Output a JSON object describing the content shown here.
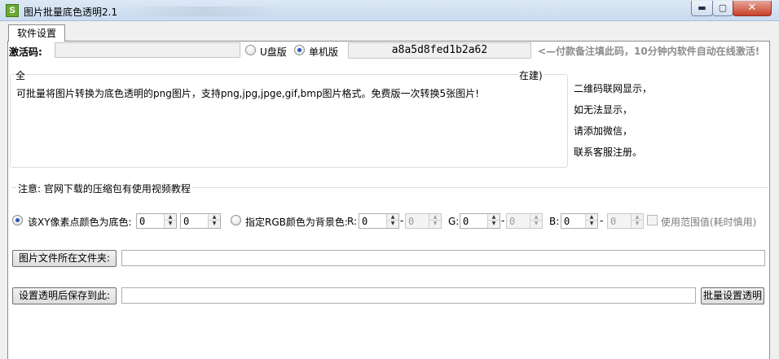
{
  "window": {
    "title": "图片批量底色透明2.1",
    "icon_text": "S",
    "buttons": {
      "minimize": "▬",
      "maximize": "▢",
      "close": "✕"
    }
  },
  "tabs": [
    {
      "label": "软件设置",
      "active": true
    }
  ],
  "activation": {
    "label": "激活码:",
    "input_value": "",
    "edition_options": [
      {
        "label": "U盘版",
        "selected": false
      },
      {
        "label": "单机版",
        "selected": true
      }
    ],
    "machine_code": "a8a5d8fed1b2a62",
    "hint": "<—付款备注填此码，10分钟内软件自动在线激活!"
  },
  "info": {
    "legend_left": "全",
    "legend_right": "在建)",
    "description": "可批量将图片转换为底色透明的png图片，支持png,jpg,jpge,gif,bmp图片格式。免费版一次转换5张图片!",
    "qr_lines": [
      "二维码联网显示，",
      "如无法显示，",
      "请添加微信，",
      "联系客服注册。"
    ]
  },
  "notice": {
    "text": "注意: 官网下载的压缩包有使用视频教程"
  },
  "color_mode": {
    "xy_option": {
      "label": "该XY像素点颜色为底色:",
      "selected": true,
      "x": "0",
      "y": "0"
    },
    "rgb_option": {
      "label": "指定RGB颜色为背景色:",
      "selected": false,
      "r_label": "R:",
      "r": "0",
      "r2": "0",
      "g_label": "G:",
      "g": "0",
      "g2": "0",
      "b_label": "B:",
      "b": "0",
      "b2": "0",
      "range_label": "使用范围值(耗时慎用)",
      "range_checked": false
    },
    "dash": "-"
  },
  "folders": {
    "source_button": "图片文件所在文件夹:",
    "source_path": "",
    "save_button": "设置透明后保存到此:",
    "save_path": "",
    "batch_button": "批量设置透明"
  },
  "colors": {
    "accent_radio": "#2c59b8",
    "hint_gray": "#8c8c8c"
  }
}
